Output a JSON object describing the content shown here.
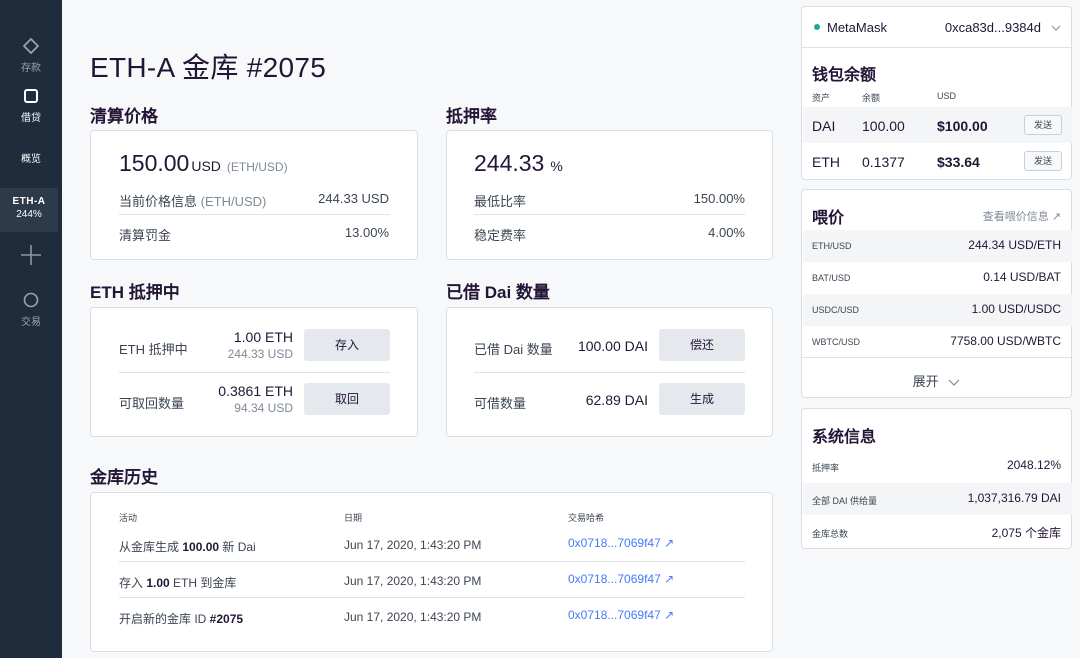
{
  "nav": {
    "deposit": "存款",
    "borrow": "借贷",
    "overview": "概览",
    "vault_name": "ETH-A",
    "vault_ratio": "244%",
    "trade": "交易"
  },
  "title": "ETH-A 金库 #2075",
  "liquidation": {
    "heading": "清算价格",
    "price": "150.00",
    "unit": "USD",
    "pair": "(ETH/USD)",
    "current_label": "当前价格信息",
    "current_label_sub": "(ETH/USD)",
    "current_value": "244.33 USD",
    "penalty_label": "清算罚金",
    "penalty_value": "13.00%"
  },
  "collat_ratio": {
    "heading": "抵押率",
    "value": "244.33",
    "unit": "%",
    "min_label": "最低比率",
    "min_value": "150.00%",
    "fee_label": "稳定费率",
    "fee_value": "4.00%"
  },
  "eth_locked": {
    "heading": "ETH 抵押中",
    "locked_label": "ETH 抵押中",
    "locked_amount": "1.00 ETH",
    "locked_usd": "244.33 USD",
    "deposit_btn": "存入",
    "withdrawable_label": "可取回数量",
    "withdrawable_amount": "0.3861 ETH",
    "withdrawable_usd": "94.34 USD",
    "withdraw_btn": "取回"
  },
  "dai_borrowed": {
    "heading": "已借 Dai 数量",
    "borrowed_label": "已借 Dai 数量",
    "borrowed_amount": "100.00 DAI",
    "payback_btn": "偿还",
    "available_label": "可借数量",
    "available_amount": "62.89 DAI",
    "generate_btn": "生成"
  },
  "history": {
    "heading": "金库历史",
    "columns": [
      "活动",
      "日期",
      "交易哈希"
    ],
    "rows": [
      {
        "pre": "从金库生成 ",
        "bold": "100.00",
        "post": " 新 Dai",
        "date": "Jun 17, 2020, 1:43:20 PM",
        "hash": "0x0718...7069f47 ↗"
      },
      {
        "pre": "存入 ",
        "bold": "1.00",
        "post": " ETH 到金库",
        "date": "Jun 17, 2020, 1:43:20 PM",
        "hash": "0x0718...7069f47 ↗"
      },
      {
        "pre": "开启新的金库 ID ",
        "bold": "#2075",
        "post": "",
        "date": "Jun 17, 2020, 1:43:20 PM",
        "hash": "0x0718...7069f47 ↗"
      }
    ]
  },
  "wallet": {
    "provider": "MetaMask",
    "address": "0xca83d...9384d",
    "heading": "钱包余额",
    "cols": [
      "资产",
      "余额",
      "USD"
    ],
    "assets": [
      {
        "asset": "DAI",
        "balance": "100.00",
        "usd": "$100.00",
        "action": "发送"
      },
      {
        "asset": "ETH",
        "balance": "0.1377",
        "usd": "$33.64",
        "action": "发送"
      }
    ],
    "status_color": "#1aab9b"
  },
  "feeds": {
    "heading": "喂价",
    "link": "查看喂价信息 ↗",
    "rows": [
      {
        "pair": "ETH/USD",
        "value": "244.34 USD/ETH"
      },
      {
        "pair": "BAT/USD",
        "value": "0.14 USD/BAT"
      },
      {
        "pair": "USDC/USD",
        "value": "1.00 USD/USDC"
      },
      {
        "pair": "WBTC/USD",
        "value": "7758.00 USD/WBTC"
      }
    ],
    "expand": "展开"
  },
  "system": {
    "heading": "系统信息",
    "rows": [
      {
        "label": "抵押率",
        "value": "2048.12%"
      },
      {
        "label": "全部 DAI 供给量",
        "value": "1,037,316.79 DAI"
      },
      {
        "label": "金库总数",
        "value": "2,075 个金库"
      }
    ]
  }
}
